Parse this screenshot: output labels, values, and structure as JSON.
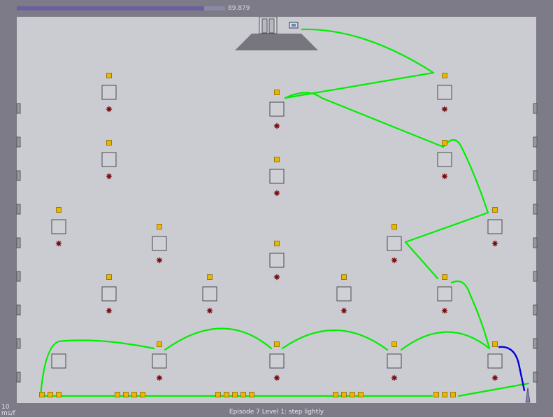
{
  "hud": {
    "time_remaining": "89.879",
    "time_fraction": 0.8988,
    "fps_text": "10\nms/f",
    "episode_title": "Episode 7 Level 1: step lightly"
  },
  "colors": {
    "background": "#7c7b87",
    "level_floor": "#cbcbd2",
    "block_fill": "#cfcfd6",
    "block_stroke": "#4a4a50",
    "gold": "#e8b800",
    "gold_border": "#8a6a00",
    "mine": "#7a0e10",
    "path_green": "#00ee00",
    "path_blue": "#0000dd",
    "exit_ramp": "#77767f",
    "wall_stud": "#9a9aa2"
  },
  "icons": {
    "exit_door": "exit-door-icon",
    "exit_switch": "exit-switch-icon",
    "ninja": "ninja-icon",
    "gold": "gold-icon",
    "mine": "mine-icon",
    "block": "block-tile"
  }
}
